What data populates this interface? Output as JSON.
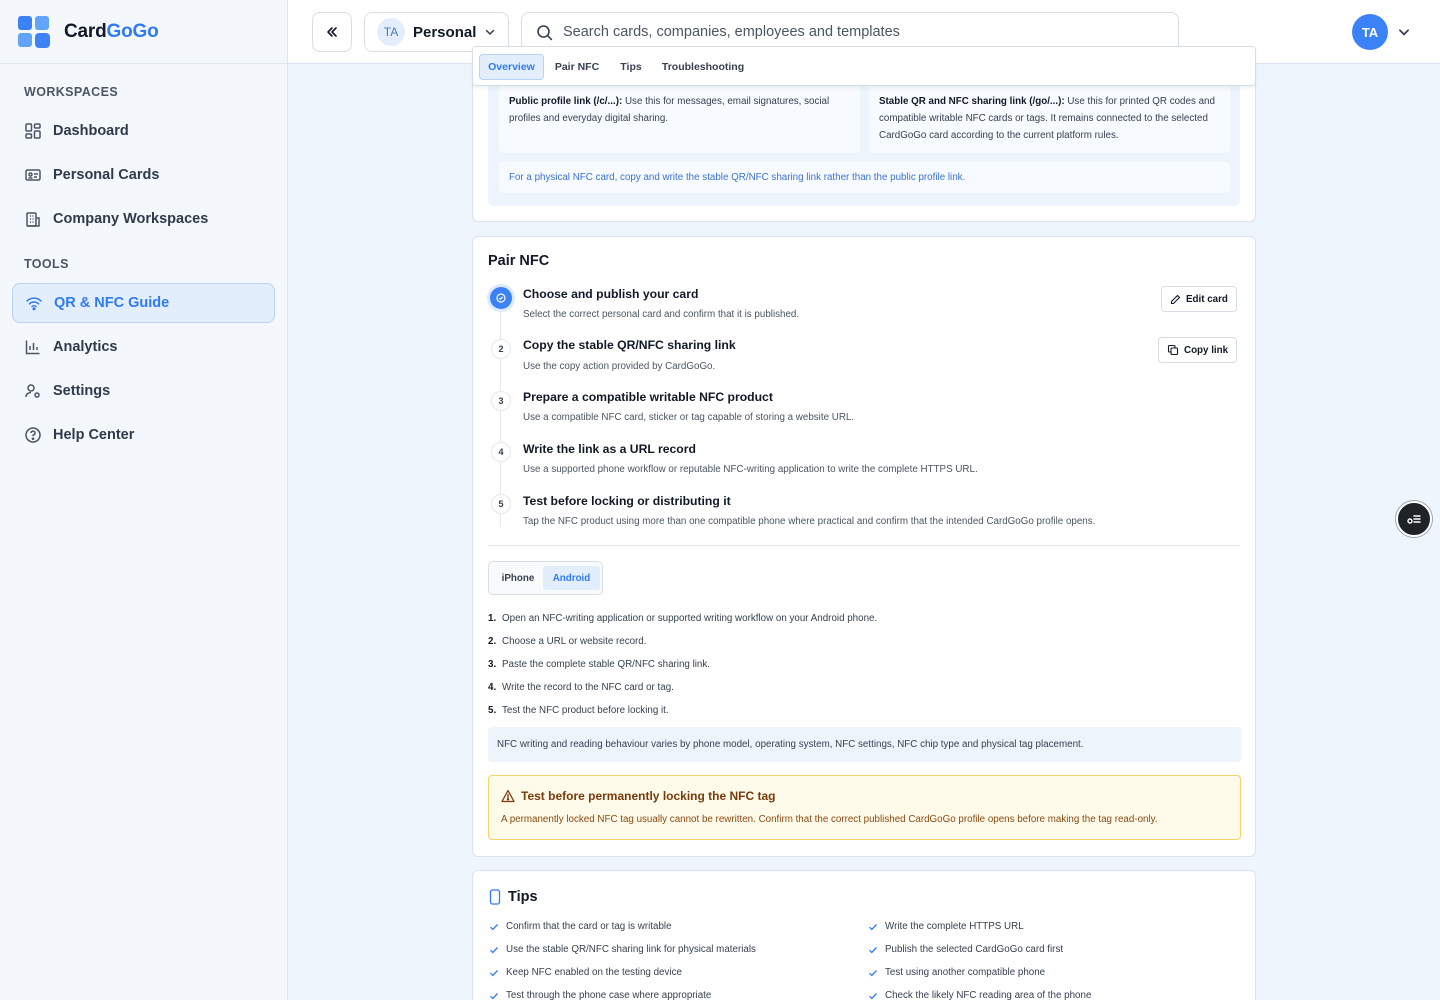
{
  "brand": {
    "name_prefix": "Card",
    "name_suffix": "GoGo"
  },
  "sidebar": {
    "workspaces_label": "WORKSPACES",
    "tools_label": "TOOLS",
    "items": [
      {
        "label": "Dashboard",
        "icon": "grid-icon"
      },
      {
        "label": "Personal Cards",
        "icon": "id-card-icon"
      },
      {
        "label": "Company Workspaces",
        "icon": "building-icon"
      },
      {
        "label": "QR & NFC Guide",
        "icon": "wifi-icon",
        "active": true
      },
      {
        "label": "Analytics",
        "icon": "bar-chart-icon"
      },
      {
        "label": "Settings",
        "icon": "user-settings-icon"
      },
      {
        "label": "Help Center",
        "icon": "help-circle-icon"
      }
    ]
  },
  "topbar": {
    "workspace": {
      "initials": "TA",
      "name": "Personal"
    },
    "search_placeholder": "Search cards, companies, employees and templates",
    "user_initials": "TA"
  },
  "tabs": [
    "Overview",
    "Pair NFC",
    "Tips",
    "Troubleshooting"
  ],
  "overview": {
    "public_link_label": "Public profile link (/c/...):",
    "public_link_text": "Use this for messages, email signatures, social profiles and everyday digital sharing.",
    "stable_link_label": "Stable QR and NFC sharing link (/go/...):",
    "stable_link_text": "Use this for printed QR codes and compatible writable NFC cards or tags. It remains connected to the selected CardGoGo card according to the current platform rules.",
    "note": "For a physical NFC card, copy and write the stable QR/NFC sharing link rather than the public profile link."
  },
  "pair": {
    "title": "Pair NFC",
    "steps": [
      {
        "num": "✓",
        "title": "Choose and publish your card",
        "desc": "Select the correct personal card and confirm that it is published."
      },
      {
        "num": "2",
        "title": "Copy the stable QR/NFC sharing link",
        "desc": "Use the copy action provided by CardGoGo."
      },
      {
        "num": "3",
        "title": "Prepare a compatible writable NFC product",
        "desc": "Use a compatible NFC card, sticker or tag capable of storing a website URL."
      },
      {
        "num": "4",
        "title": "Write the link as a URL record",
        "desc": "Use a supported phone workflow or reputable NFC-writing application to write the complete HTTPS URL."
      },
      {
        "num": "5",
        "title": "Test before locking or distributing it",
        "desc": "Tap the NFC product using more than one compatible phone where practical and confirm that the intended CardGoGo profile opens."
      }
    ],
    "edit_card_label": "Edit card",
    "copy_link_label": "Copy link",
    "platforms": [
      "iPhone",
      "Android"
    ],
    "android_steps": [
      {
        "n": "1.",
        "text": "Open an NFC-writing application or supported writing workflow on your Android phone."
      },
      {
        "n": "2.",
        "text": "Choose a URL or website record."
      },
      {
        "n": "3.",
        "text": "Paste the complete stable QR/NFC sharing link."
      },
      {
        "n": "4.",
        "text": "Write the record to the NFC card or tag."
      },
      {
        "n": "5.",
        "text": "Test the NFC product before locking it."
      }
    ],
    "info": "NFC writing and reading behaviour varies by phone model, operating system, NFC settings, NFC chip type and physical tag placement.",
    "warning_title": "Test before permanently locking the NFC tag",
    "warning_text": "A permanently locked NFC tag usually cannot be rewritten. Confirm that the correct published CardGoGo profile opens before making the tag read-only."
  },
  "tips": {
    "title": "Tips",
    "left": [
      "Confirm that the card or tag is writable",
      "Use the stable QR/NFC sharing link for physical materials",
      "Keep NFC enabled on the testing device",
      "Test through the phone case where appropriate"
    ],
    "right": [
      "Write the complete HTTPS URL",
      "Publish the selected CardGoGo card first",
      "Test using another compatible phone",
      "Check the likely NFC reading area of the phone"
    ]
  },
  "colors": {
    "accent": "#2f7bf2",
    "warning_bg": "#fffbea",
    "warning_border": "#f5d36b"
  }
}
